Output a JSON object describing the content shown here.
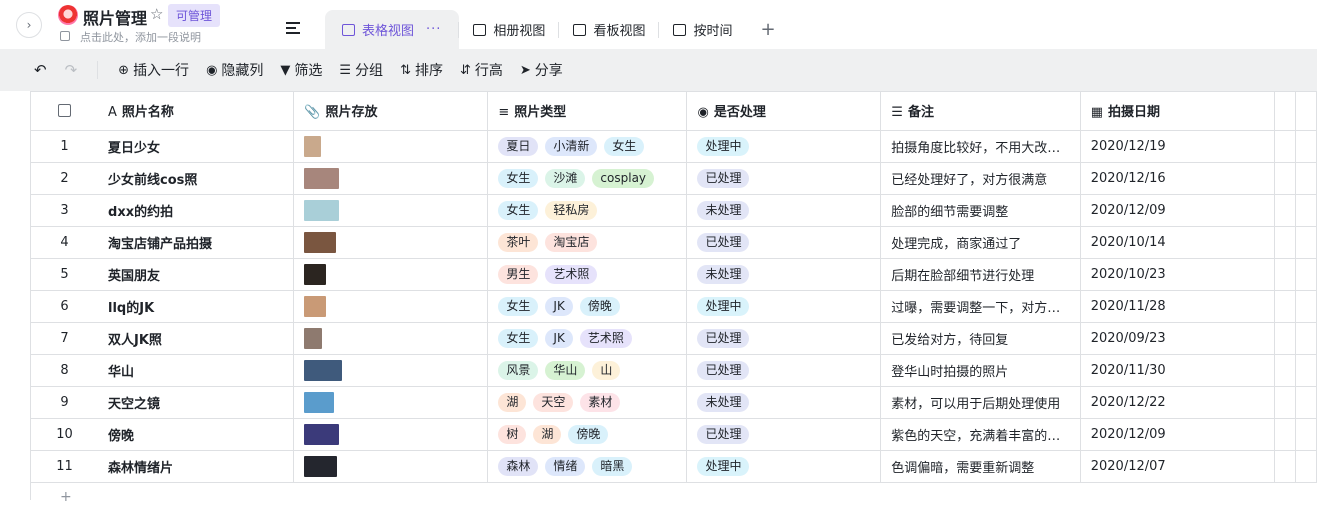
{
  "app": {
    "title": "照片管理",
    "badge": "可管理",
    "description": "点击此处，添加一段说明"
  },
  "views": [
    {
      "label": "表格视图",
      "icon": "table-icon",
      "active": true
    },
    {
      "label": "相册视图",
      "icon": "gallery-icon",
      "active": false
    },
    {
      "label": "看板视图",
      "icon": "kanban-icon",
      "active": false
    },
    {
      "label": "按时间",
      "icon": "timeline-icon",
      "active": false
    }
  ],
  "toolbar": {
    "insert_row": "插入一行",
    "hide_columns": "隐藏列",
    "filter": "筛选",
    "group": "分组",
    "sort": "排序",
    "row_height": "行高",
    "share": "分享"
  },
  "columns": [
    {
      "label": "照片名称",
      "icon": "text-icon"
    },
    {
      "label": "照片存放",
      "icon": "attachment-icon"
    },
    {
      "label": "照片类型",
      "icon": "multi-select-icon"
    },
    {
      "label": "是否处理",
      "icon": "single-select-icon"
    },
    {
      "label": "备注",
      "icon": "note-icon"
    },
    {
      "label": "拍摄日期",
      "icon": "calendar-icon"
    }
  ],
  "colors": {
    "accent": "#6e55d9",
    "status_processing": "#d9f3fb",
    "status_done": "#e2e5f6",
    "status_pending": "#e2e5f6"
  },
  "rows": [
    {
      "idx": "1",
      "name": "夏日少女",
      "thumb_color": "#c9a98c",
      "tags": [
        "夏日",
        "小清新",
        "女生"
      ],
      "status": "处理中",
      "note": "拍摄角度比较好，不用大改…",
      "date": "2020/12/19"
    },
    {
      "idx": "2",
      "name": "少女前线cos照",
      "thumb_color": "#a7867c",
      "tags": [
        "女生",
        "沙滩",
        "cosplay"
      ],
      "status": "已处理",
      "note": "已经处理好了，对方很满意",
      "date": "2020/12/16"
    },
    {
      "idx": "3",
      "name": "dxx的约拍",
      "thumb_color": "#a9cfd8",
      "tags": [
        "女生",
        "轻私房"
      ],
      "status": "未处理",
      "note": "脸部的细节需要调整",
      "date": "2020/12/09"
    },
    {
      "idx": "4",
      "name": "淘宝店铺产品拍摄",
      "thumb_color": "#7a5640",
      "tags": [
        "茶叶",
        "淘宝店"
      ],
      "status": "已处理",
      "note": "处理完成，商家通过了",
      "date": "2020/10/14"
    },
    {
      "idx": "5",
      "name": "英国朋友",
      "thumb_color": "#2b2520",
      "tags": [
        "男生",
        "艺术照"
      ],
      "status": "未处理",
      "note": "后期在脸部细节进行处理",
      "date": "2020/10/23"
    },
    {
      "idx": "6",
      "name": "llq的JK",
      "thumb_color": "#c99a76",
      "tags": [
        "女生",
        "JK",
        "傍晚"
      ],
      "status": "处理中",
      "note": "过曝，需要调整一下，对方…",
      "date": "2020/11/28"
    },
    {
      "idx": "7",
      "name": "双人JK照",
      "thumb_color": "#8e7a6f",
      "tags": [
        "女生",
        "JK",
        "艺术照"
      ],
      "status": "已处理",
      "note": "已发给对方，待回复",
      "date": "2020/09/23"
    },
    {
      "idx": "8",
      "name": "华山",
      "thumb_color": "#3f5a7c",
      "tags": [
        "风景",
        "华山",
        "山"
      ],
      "status": "已处理",
      "note": "登华山时拍摄的照片",
      "date": "2020/11/30"
    },
    {
      "idx": "9",
      "name": "天空之镜",
      "thumb_color": "#5a9ccc",
      "tags": [
        "湖",
        "天空",
        "素材"
      ],
      "status": "未处理",
      "note": "素材，可以用于后期处理使用",
      "date": "2020/12/22"
    },
    {
      "idx": "10",
      "name": "傍晚",
      "thumb_color": "#3b3a7a",
      "tags": [
        "树",
        "湖",
        "傍晚"
      ],
      "status": "已处理",
      "note": "紫色的天空，充满着丰富的…",
      "date": "2020/12/09"
    },
    {
      "idx": "11",
      "name": "森林情绪片",
      "thumb_color": "#24262e",
      "tags": [
        "森林",
        "情绪",
        "暗黑"
      ],
      "status": "处理中",
      "note": "色调偏暗，需要重新调整",
      "date": "2020/12/07"
    }
  ],
  "tag_colors": {
    "夏日": "#e1e3f7",
    "小清新": "#dde7fb",
    "女生": "#d9f1fb",
    "沙滩": "#dbf4e8",
    "cosplay": "#d6f2d2",
    "轻私房": "#fdf1d9",
    "茶叶": "#fde5d6",
    "淘宝店": "#fde3de",
    "男生": "#fde3de",
    "艺术照": "#e6e2fb",
    "JK": "#dde7fb",
    "傍晚": "#d9f1fb",
    "风景": "#dbf4e8",
    "华山": "#d6f2d2",
    "山": "#fdf1d9",
    "湖": "#fde5d6",
    "天空": "#fde3de",
    "素材": "#fde3e8",
    "树": "#fde3de",
    "森林": "#e1e3f7",
    "情绪": "#dde7fb",
    "暗黑": "#d9f1fb"
  }
}
